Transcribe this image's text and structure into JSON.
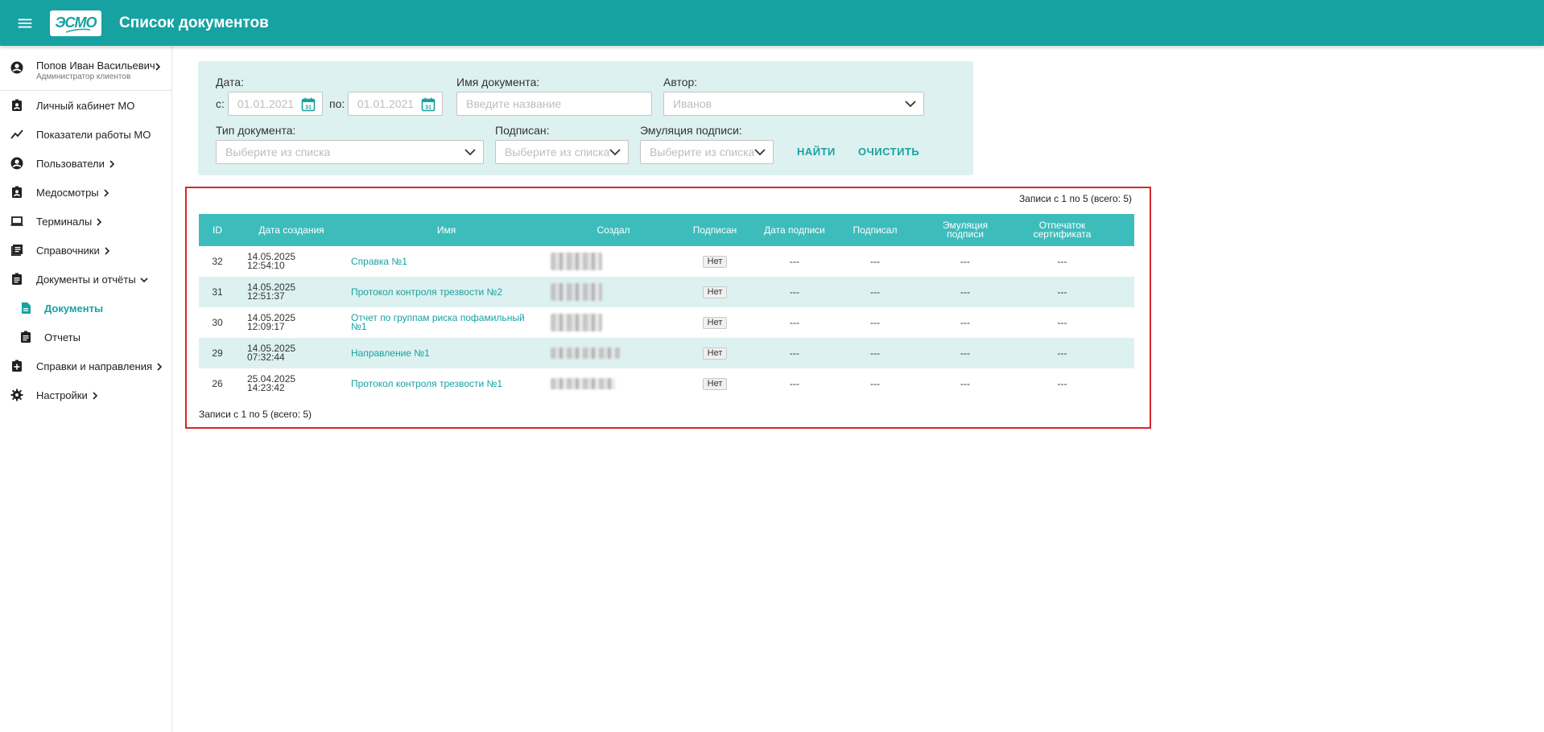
{
  "header": {
    "title": "Список документов",
    "logo_text": "ЭСМО"
  },
  "sidebar": {
    "user": {
      "name": "Попов Иван Васильевич",
      "role": "Администратор клиентов"
    },
    "items": [
      {
        "label": "Личный кабинет МО",
        "icon": "id-badge-icon"
      },
      {
        "label": "Показатели работы МО",
        "icon": "trend-line-icon"
      },
      {
        "label": "Пользователи",
        "icon": "user-circle-icon"
      },
      {
        "label": "Медосмотры",
        "icon": "clipboard-user-icon"
      },
      {
        "label": "Терминалы",
        "icon": "laptop-icon"
      },
      {
        "label": "Справочники",
        "icon": "list-book-icon"
      },
      {
        "label": "Документы и отчёты",
        "icon": "clipboard-icon"
      },
      {
        "label": "Документы",
        "icon": "document-icon"
      },
      {
        "label": "Отчеты",
        "icon": "report-icon"
      },
      {
        "label": "Справки и направления",
        "icon": "clipboard-plus-icon"
      },
      {
        "label": "Настройки",
        "icon": "gear-icon"
      }
    ]
  },
  "filters": {
    "date_label": "Дата:",
    "from_label": "с:",
    "from_placeholder": "01.01.2021",
    "to_label": "по:",
    "to_placeholder": "01.01.2021",
    "doc_name_label": "Имя документа:",
    "doc_name_placeholder": "Введите название",
    "author_label": "Автор:",
    "author_value": "Иванов",
    "doc_type_label": "Тип документа:",
    "doc_type_placeholder": "Выберите из списка",
    "signed_label": "Подписан:",
    "signed_placeholder": "Выберите из списка",
    "emulation_label": "Эмуляция подписи:",
    "emulation_placeholder": "Выберите из списка",
    "find_button": "НАЙТИ",
    "clear_button": "ОЧИСТИТЬ"
  },
  "table": {
    "records_info": "Записи с 1 по 5 (всего: 5)",
    "headers": {
      "id": "ID",
      "created": "Дата создания",
      "name": "Имя",
      "author": "Создал",
      "signed": "Подписан",
      "sign_date": "Дата подписи",
      "signer": "Подписал",
      "emulation": "Эмуляция подписи",
      "fingerprint": "Отпечаток сертификата"
    },
    "rows": [
      {
        "id": "32",
        "date": "14.05.2025",
        "time": "12:54:10",
        "name": "Справка №1",
        "signed": "Нет",
        "sign_date": "---",
        "signer": "---",
        "emulation": "---",
        "fingerprint": "---"
      },
      {
        "id": "31",
        "date": "14.05.2025",
        "time": "12:51:37",
        "name": "Протокол контроля трезвости №2",
        "signed": "Нет",
        "sign_date": "---",
        "signer": "---",
        "emulation": "---",
        "fingerprint": "---"
      },
      {
        "id": "30",
        "date": "14.05.2025",
        "time": "12:09:17",
        "name": "Отчет по группам риска пофамильный №1",
        "signed": "Нет",
        "sign_date": "---",
        "signer": "---",
        "emulation": "---",
        "fingerprint": "---"
      },
      {
        "id": "29",
        "date": "14.05.2025",
        "time": "07:32:44",
        "name": "Направление №1",
        "signed": "Нет",
        "sign_date": "---",
        "signer": "---",
        "emulation": "---",
        "fingerprint": "---"
      },
      {
        "id": "26",
        "date": "25.04.2025",
        "time": "14:23:42",
        "name": "Протокол контроля трезвости №1",
        "signed": "Нет",
        "sign_date": "---",
        "signer": "---",
        "emulation": "---",
        "fingerprint": "---"
      }
    ]
  },
  "colors": {
    "accent": "#17a2a2",
    "table_header": "#3dbcbc",
    "panel": "#ddf1f0",
    "highlight_border": "#d6262d"
  }
}
